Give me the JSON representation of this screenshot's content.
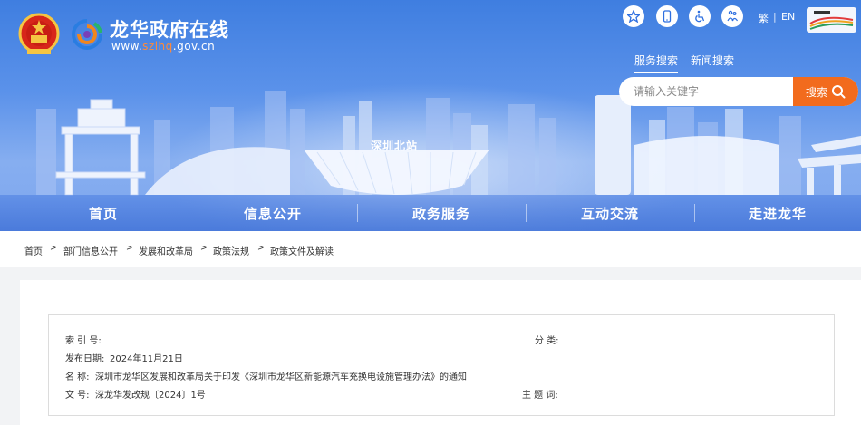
{
  "header": {
    "site_title": "龙华政府在线",
    "domain_prefix": "www.",
    "domain_highlight": "szlhq",
    "domain_suffix": ".gov.cn",
    "tools": [
      {
        "name": "accessibility-star-icon"
      },
      {
        "name": "mobile-icon"
      },
      {
        "name": "wheelchair-icon"
      },
      {
        "name": "elderly-care-icon"
      }
    ],
    "lang_traditional": "繁",
    "lang_separator": "|",
    "lang_english": "EN",
    "accent_color": "#f26b1d"
  },
  "search": {
    "tabs": [
      "服务搜索",
      "新闻搜索"
    ],
    "placeholder": "请输入关键字",
    "button_label": "搜索"
  },
  "banner": {
    "station_label": "深圳北站"
  },
  "nav": {
    "items": [
      "首页",
      "信息公开",
      "政务服务",
      "互动交流",
      "走进龙华"
    ]
  },
  "breadcrumb": {
    "items": [
      "首页",
      "部门信息公开",
      "发展和改革局",
      "政策法规",
      "政策文件及解读"
    ],
    "separator": ">"
  },
  "doc_info": {
    "index_label": "索 引 号:",
    "index_value": "",
    "category_label": "分 类:",
    "category_value": "",
    "date_label": "发布日期:",
    "date_value": "2024年11月21日",
    "name_label": "名 称:",
    "name_value": "深圳市龙华区发展和改革局关于印发《深圳市龙华区新能源汽车充换电设施管理办法》的通知",
    "number_label": "文 号:",
    "number_value": "深龙华发改规〔2024〕1号",
    "subject_label": "主 题 词:",
    "subject_value": ""
  }
}
